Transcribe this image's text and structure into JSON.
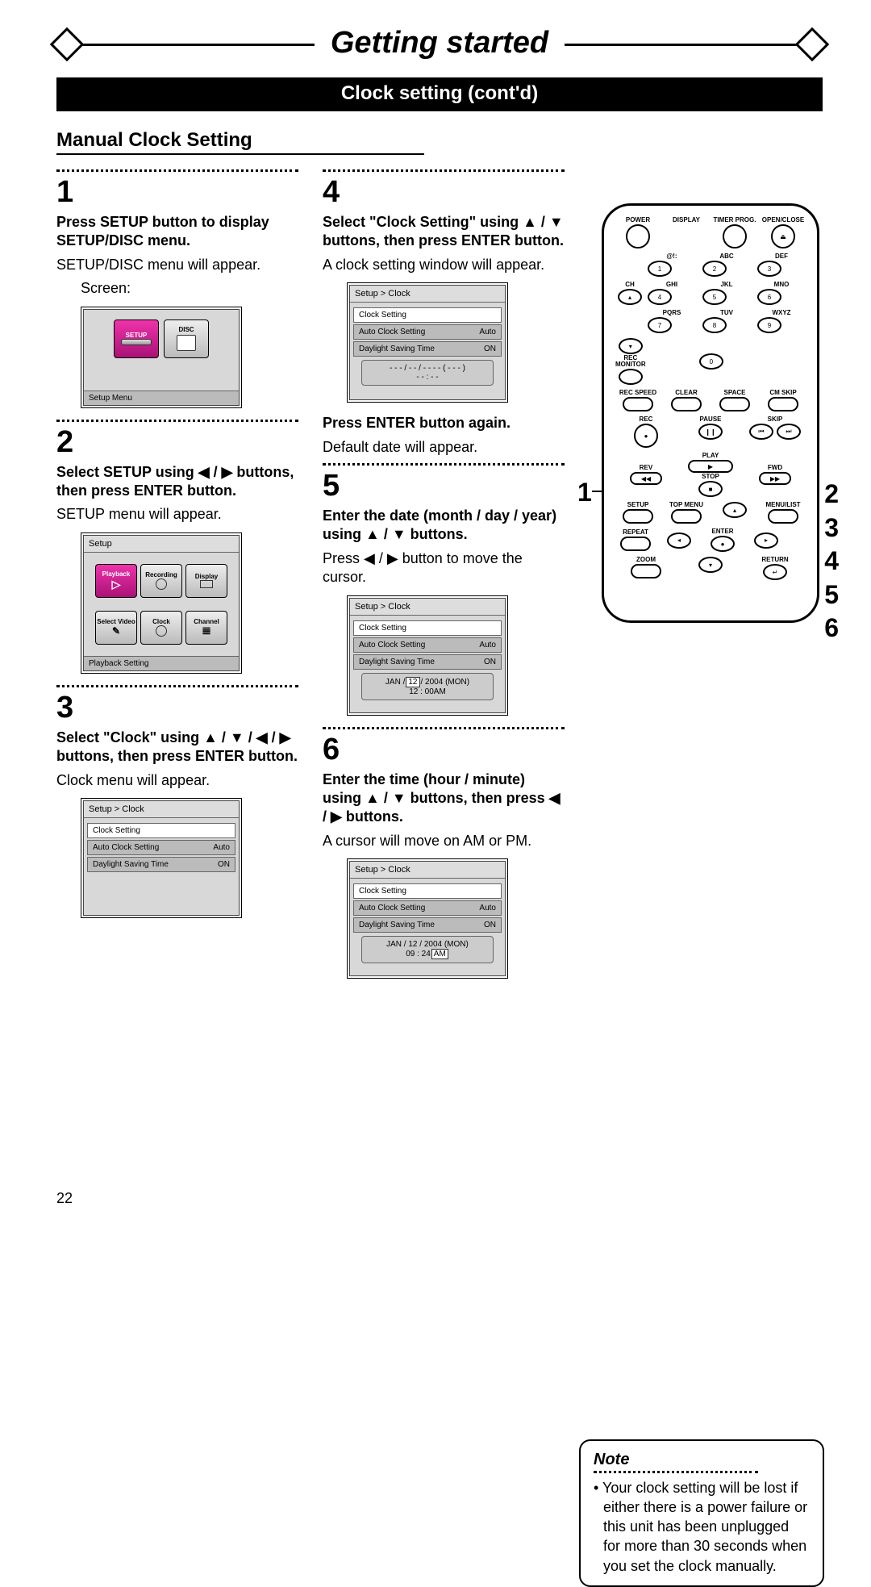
{
  "banner": {
    "title": "Getting started",
    "subtitle": "Clock setting (cont'd)"
  },
  "section": "Manual Clock Setting",
  "steps": {
    "s1": {
      "n": "1",
      "bold": "Press SETUP button to display SETUP/DISC menu.",
      "text": "SETUP/DISC menu will appear.",
      "screen_label": "Screen:",
      "sshot": {
        "tiles": [
          "SETUP",
          "DISC"
        ],
        "footer": "Setup Menu"
      }
    },
    "s2": {
      "n": "2",
      "bold": "Select SETUP using ◀ / ▶ buttons, then press ENTER button.",
      "text": "SETUP menu will appear.",
      "sshot": {
        "head": "Setup",
        "row1": [
          "Playback",
          "Recording",
          "Display"
        ],
        "row2": [
          "Select Video",
          "Clock",
          "Channel"
        ],
        "footer": "Playback Setting"
      }
    },
    "s3": {
      "n": "3",
      "bold": "Select \"Clock\" using ▲ / ▼ / ◀ / ▶ buttons, then press ENTER button.",
      "text": "Clock menu will appear.",
      "sshot": {
        "head": "Setup > Clock",
        "rows": [
          {
            "l": "Clock Setting",
            "r": ""
          },
          {
            "l": "Auto Clock Setting",
            "r": "Auto"
          },
          {
            "l": "Daylight Saving Time",
            "r": "ON"
          }
        ]
      }
    },
    "s4": {
      "n": "4",
      "bold": "Select \"Clock Setting\" using ▲ / ▼ buttons, then press ENTER button.",
      "text": "A clock setting window will appear.",
      "sshot": {
        "head": "Setup > Clock",
        "rows": [
          {
            "l": "Clock Setting",
            "r": ""
          },
          {
            "l": "Auto Clock Setting",
            "r": "Auto"
          },
          {
            "l": "Daylight Saving Time",
            "r": "ON"
          }
        ],
        "date": "- - - / - - / - - - -  ( - - - )",
        "time": "- - : - -"
      },
      "bold2": "Press ENTER button again.",
      "text2": "Default date will appear."
    },
    "s5": {
      "n": "5",
      "bold": "Enter the date (month / day / year) using ▲ / ▼ buttons.",
      "text": "Press ◀ / ▶ button to move the cursor.",
      "sshot": {
        "head": "Setup > Clock",
        "rows": [
          {
            "l": "Clock Setting",
            "r": ""
          },
          {
            "l": "Auto Clock Setting",
            "r": "Auto"
          },
          {
            "l": "Daylight Saving Time",
            "r": "ON"
          }
        ],
        "date_parts": [
          "JAN /",
          "12",
          "/ 2004 (MON)"
        ],
        "time": "12 : 00AM"
      }
    },
    "s6": {
      "n": "6",
      "bold": "Enter the time (hour / minute) using ▲ / ▼ buttons, then press ◀ / ▶ buttons.",
      "text": "A cursor will move on AM or PM.",
      "sshot": {
        "head": "Setup > Clock",
        "rows": [
          {
            "l": "Clock Setting",
            "r": ""
          },
          {
            "l": "Auto Clock Setting",
            "r": "Auto"
          },
          {
            "l": "Daylight Saving Time",
            "r": "ON"
          }
        ],
        "date": "JAN / 12 / 2004 (MON)",
        "time_parts": [
          "09 : 24",
          "AM"
        ]
      }
    }
  },
  "remote": {
    "top": {
      "power": "POWER",
      "display": "DISPLAY",
      "timer": "TIMER PROG.",
      "open": "OPEN/CLOSE"
    },
    "numpad_labels": [
      "@!:",
      "ABC",
      "DEF",
      "GHI",
      "JKL",
      "MNO",
      "PQRS",
      "TUV",
      "WXYZ"
    ],
    "numpad_nums": [
      "1",
      "2",
      "3",
      "4",
      "5",
      "6",
      "7",
      "8",
      "9",
      "0"
    ],
    "side": {
      "ch": "CH",
      "rec_monitor": "REC MONITOR",
      "rec_speed": "REC SPEED",
      "clear": "CLEAR",
      "space": "SPACE",
      "cmskip": "CM SKIP"
    },
    "transport": {
      "rec": "REC",
      "pause": "PAUSE",
      "skip": "SKIP",
      "play": "PLAY",
      "stop": "STOP",
      "rev": "REV",
      "fwd": "FWD"
    },
    "nav": {
      "setup": "SETUP",
      "top_menu": "TOP MENU",
      "menu_list": "MENU/LIST",
      "repeat": "REPEAT",
      "enter": "ENTER",
      "zoom": "ZOOM",
      "return": "RETURN"
    },
    "callout_left": "1",
    "callouts_right": [
      "2",
      "3",
      "4",
      "5",
      "6"
    ]
  },
  "note": {
    "title": "Note",
    "text": "• Your clock setting will be lost if either there is a power failure or this unit has been unplugged for more than 30 seconds when you set the clock manually."
  },
  "pagenum": "22"
}
